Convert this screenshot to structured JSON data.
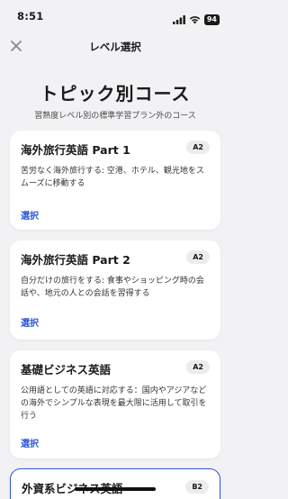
{
  "status_bar": {
    "time": "8:51",
    "battery": "94"
  },
  "nav": {
    "title": "レベル選択"
  },
  "header": {
    "title": "トピック別コース",
    "subtitle": "習熟度レベル別の標準学習プラン外のコース"
  },
  "courses": [
    {
      "title": "海外旅行英語 Part 1",
      "level": "A2",
      "description": "苦労なく海外旅行する: 空港、ホテル、観光地をスムーズに移動する",
      "action": "選択"
    },
    {
      "title": "海外旅行英語 Part 2",
      "level": "A2",
      "description": "自分だけの旅行をする: 食事やショッピング時の会話や、地元の人との会話を習得する",
      "action": "選択"
    },
    {
      "title": "基礎ビジネス英語",
      "level": "A2",
      "description": "公用語としての英語に対応する：国内やアジアなどの海外でシンプルな表現を最大限に活用して取引を行う",
      "action": "選択"
    },
    {
      "title": "外資系ビジネス英語",
      "level": "B2"
    }
  ],
  "colors": {
    "accent": "#2b55d6",
    "background": "#f2f2f4",
    "card": "#ffffff",
    "badge": "#ececef"
  },
  "icons": {
    "close": "close-icon",
    "signal": "signal-icon",
    "wifi": "wifi-icon",
    "battery": "battery-icon"
  }
}
